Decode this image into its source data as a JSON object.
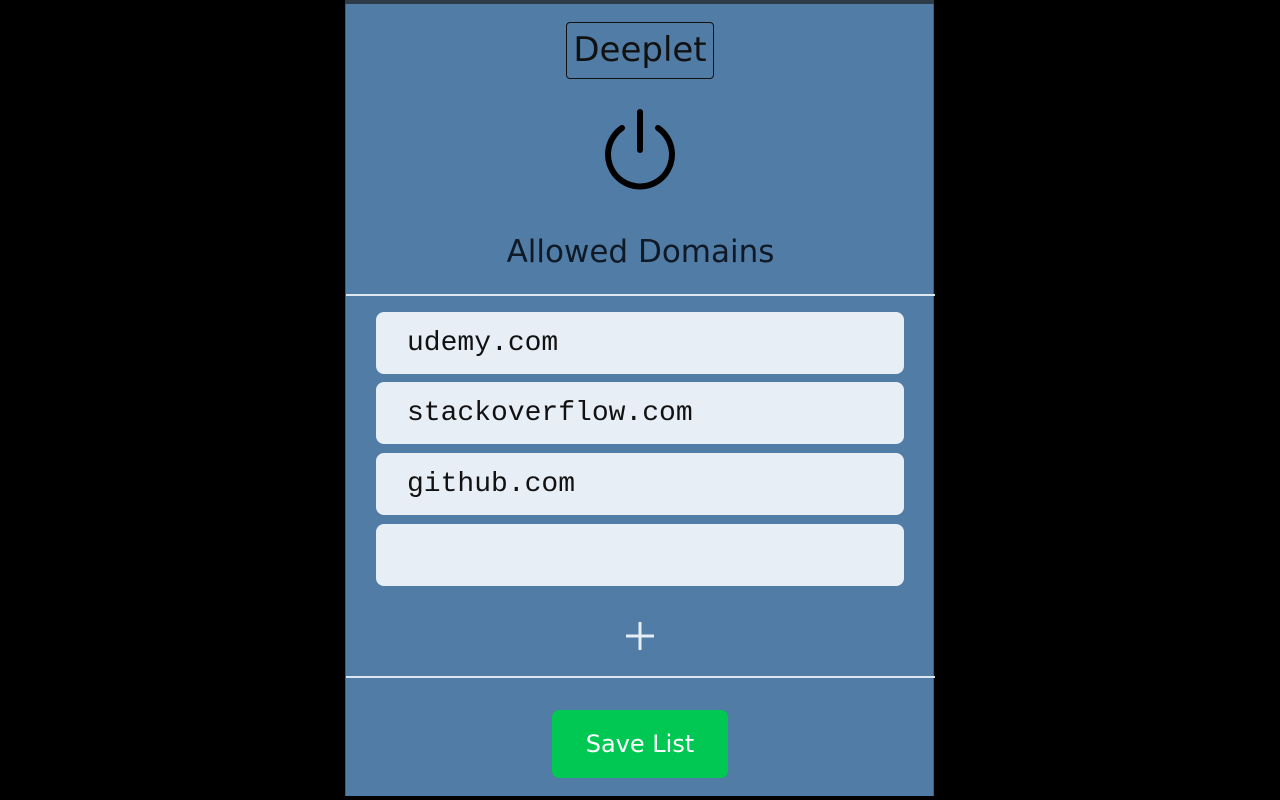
{
  "app": {
    "title": "Deeplet"
  },
  "power_icon": "power-icon",
  "allowed_domains": {
    "heading": "Allowed Domains",
    "items": [
      {
        "value": "udemy.com",
        "placeholder": ""
      },
      {
        "value": "stackoverflow.com",
        "placeholder": ""
      },
      {
        "value": "github.com",
        "placeholder": ""
      },
      {
        "value": "",
        "placeholder": ""
      }
    ],
    "add_icon": "plus-icon"
  },
  "actions": {
    "save_label": "Save List"
  },
  "colors": {
    "panel_bg": "#517ca6",
    "input_bg": "#e8eef6",
    "save_bg": "#00c853",
    "divider": "#dde7f1"
  }
}
